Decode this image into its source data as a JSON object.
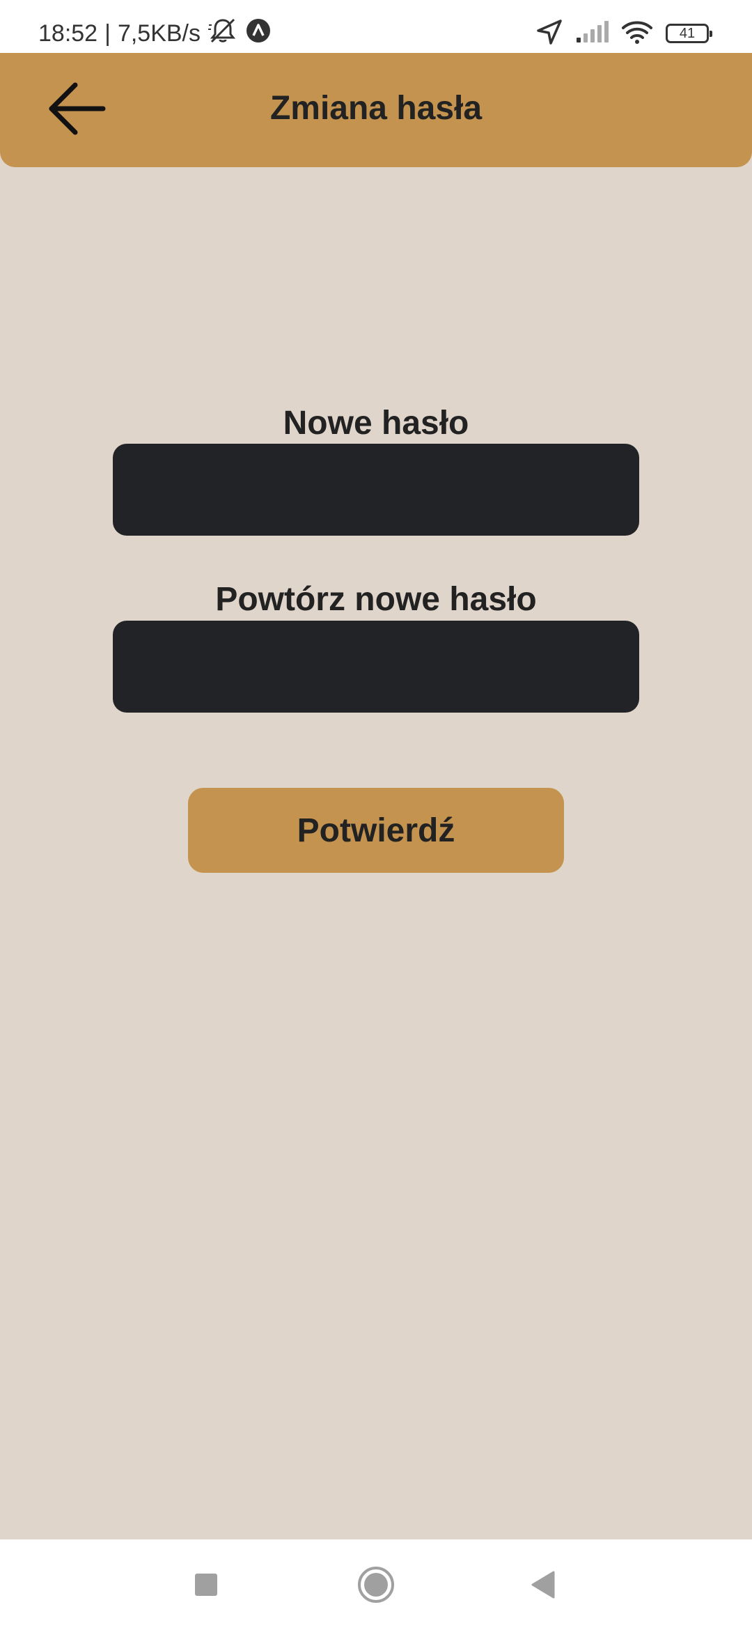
{
  "status_bar": {
    "time": "18:52",
    "separator": "|",
    "network_speed": "7,5KB/s",
    "battery_level": "41",
    "icons": [
      "muted-bell-icon",
      "app-notification-icon",
      "location-arrow-icon",
      "signal-icon",
      "wifi-icon",
      "battery-icon"
    ]
  },
  "app_bar": {
    "title": "Zmiana hasła",
    "back_icon": "arrow-left-icon"
  },
  "form": {
    "new_password_label": "Nowe hasło",
    "new_password_value": "",
    "repeat_password_label": "Powtórz nowe hasło",
    "repeat_password_value": "",
    "confirm_label": "Potwierdź"
  },
  "nav_bar": {
    "icons": [
      "recents-square-icon",
      "home-circle-icon",
      "back-triangle-icon"
    ]
  },
  "colors": {
    "background": "#e0d5ca",
    "accent": "#c4934f",
    "input_background": "#212326",
    "text": "#222222"
  }
}
